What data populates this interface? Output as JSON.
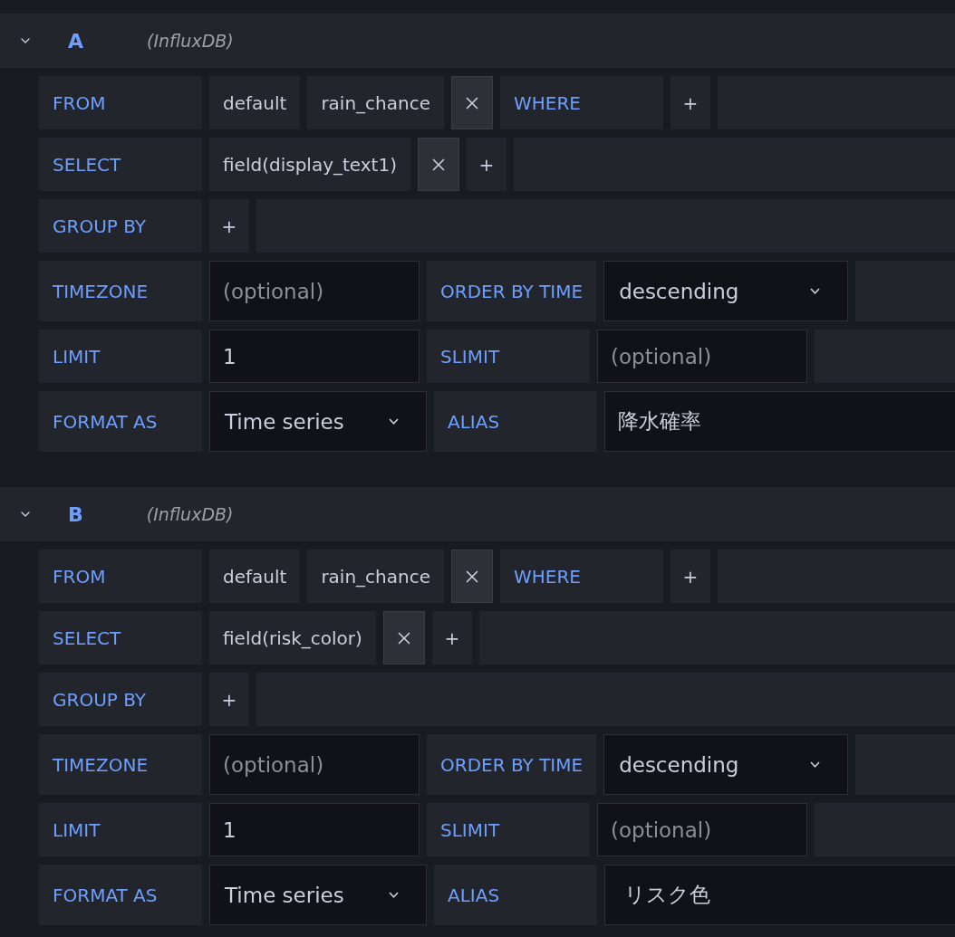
{
  "queries": [
    {
      "letter": "A",
      "datasource": "(InfluxDB)",
      "expanded": true,
      "rows": [
        {
          "parts": [
            {
              "kind": "label",
              "text": "FROM"
            },
            {
              "kind": "segment",
              "text": "default"
            },
            {
              "kind": "segment",
              "text": "rain_chance"
            },
            {
              "kind": "remove"
            },
            {
              "kind": "label",
              "text": "WHERE"
            },
            {
              "kind": "add",
              "text": "+"
            },
            {
              "kind": "filler"
            }
          ]
        },
        {
          "parts": [
            {
              "kind": "label",
              "text": "SELECT"
            },
            {
              "kind": "segment",
              "text": "field(display_text1)"
            },
            {
              "kind": "remove"
            },
            {
              "kind": "add",
              "text": "+"
            },
            {
              "kind": "filler"
            }
          ]
        },
        {
          "parts": [
            {
              "kind": "label",
              "text": "GROUP BY"
            },
            {
              "kind": "add",
              "text": "+"
            },
            {
              "kind": "filler"
            }
          ]
        },
        {
          "parts": [
            {
              "kind": "label",
              "text": "TIMEZONE"
            },
            {
              "kind": "input",
              "placeholder": "(optional)"
            },
            {
              "kind": "label",
              "text": "ORDER BY TIME"
            },
            {
              "kind": "select",
              "value": "descending"
            },
            {
              "kind": "filler"
            }
          ]
        },
        {
          "parts": [
            {
              "kind": "label",
              "text": "LIMIT"
            },
            {
              "kind": "input",
              "value": "1"
            },
            {
              "kind": "label",
              "text": "SLIMIT"
            },
            {
              "kind": "input",
              "placeholder": "(optional)"
            },
            {
              "kind": "filler"
            }
          ]
        },
        {
          "parts": [
            {
              "kind": "label",
              "text": "FORMAT AS"
            },
            {
              "kind": "select",
              "value": "Time series"
            },
            {
              "kind": "label",
              "text": "ALIAS"
            },
            {
              "kind": "wide-input",
              "value": "降水確率"
            },
            {
              "kind": "filler"
            }
          ]
        }
      ]
    },
    {
      "letter": "B",
      "datasource": "(InfluxDB)",
      "expanded": true,
      "rows": [
        {
          "parts": [
            {
              "kind": "label",
              "text": "FROM"
            },
            {
              "kind": "segment",
              "text": "default"
            },
            {
              "kind": "segment",
              "text": "rain_chance"
            },
            {
              "kind": "remove"
            },
            {
              "kind": "label",
              "text": "WHERE"
            },
            {
              "kind": "add",
              "text": "+"
            },
            {
              "kind": "filler"
            }
          ]
        },
        {
          "parts": [
            {
              "kind": "label",
              "text": "SELECT"
            },
            {
              "kind": "segment",
              "text": "field(risk_color)"
            },
            {
              "kind": "remove"
            },
            {
              "kind": "add",
              "text": "+"
            },
            {
              "kind": "filler"
            }
          ]
        },
        {
          "parts": [
            {
              "kind": "label",
              "text": "GROUP BY"
            },
            {
              "kind": "add",
              "text": "+"
            },
            {
              "kind": "filler"
            }
          ]
        },
        {
          "parts": [
            {
              "kind": "label",
              "text": "TIMEZONE"
            },
            {
              "kind": "input",
              "placeholder": "(optional)"
            },
            {
              "kind": "label",
              "text": "ORDER BY TIME"
            },
            {
              "kind": "select",
              "value": "descending"
            },
            {
              "kind": "filler"
            }
          ]
        },
        {
          "parts": [
            {
              "kind": "label",
              "text": "LIMIT"
            },
            {
              "kind": "input",
              "value": "1"
            },
            {
              "kind": "label",
              "text": "SLIMIT"
            },
            {
              "kind": "input",
              "placeholder": "(optional)"
            },
            {
              "kind": "filler"
            }
          ]
        },
        {
          "parts": [
            {
              "kind": "label",
              "text": "FORMAT AS"
            },
            {
              "kind": "select",
              "value": "Time series"
            },
            {
              "kind": "label",
              "text": "ALIAS"
            },
            {
              "kind": "wide-input",
              "value": " リスク色"
            },
            {
              "kind": "filler"
            }
          ]
        }
      ]
    }
  ]
}
